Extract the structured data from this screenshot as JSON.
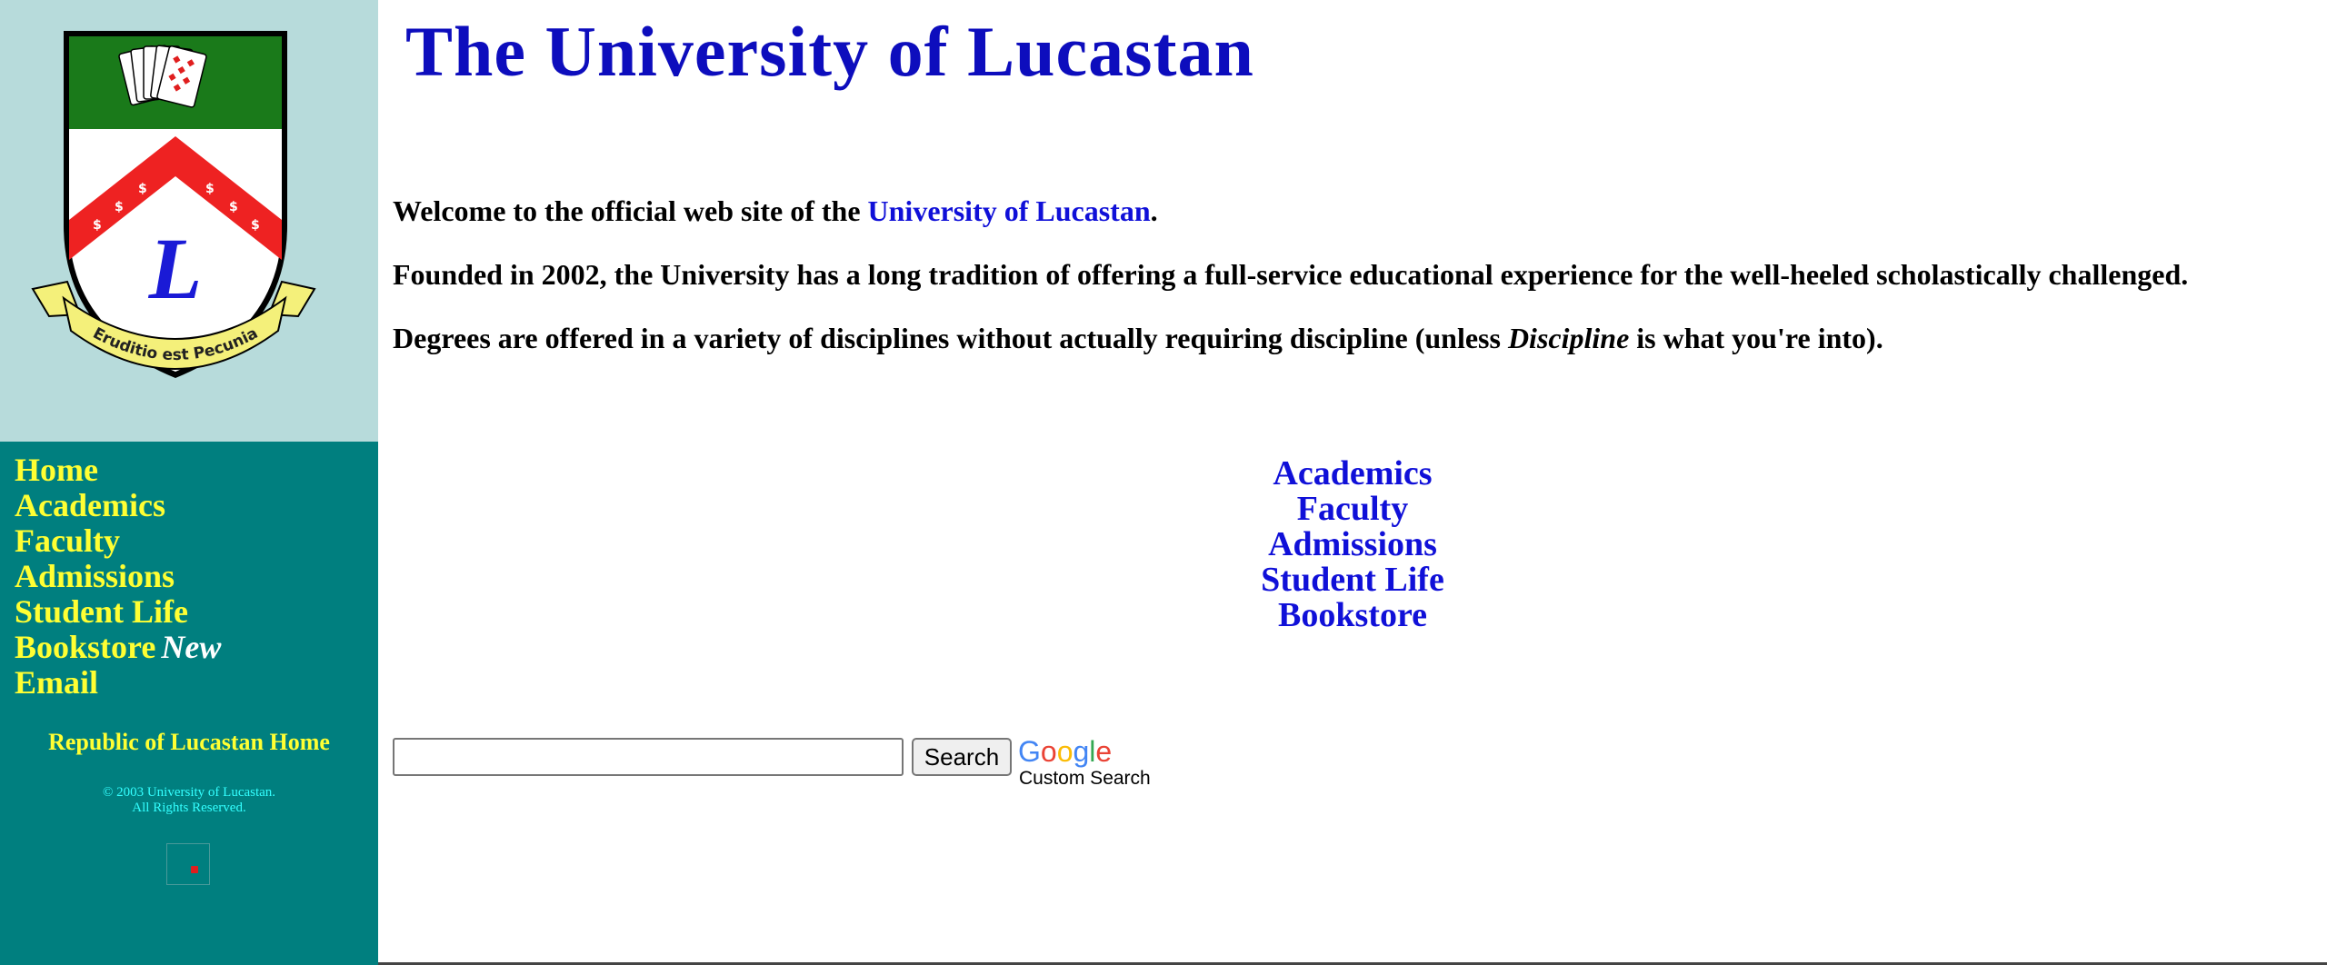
{
  "colors": {
    "sidebar_top": "#b7dbdb",
    "sidebar_nav": "#007f7f",
    "nav_text": "#ffff33",
    "link_blue": "#1010d8",
    "title_blue": "#0d0dbd",
    "crest_green": "#1a7a1a",
    "crest_red": "#ee2222",
    "banner_yellow": "#f4f07a"
  },
  "crest": {
    "motto": "Eruditio est Pecunia",
    "letter": "L",
    "dollar_sign": "$"
  },
  "sidebar": {
    "nav": [
      {
        "label": "Home"
      },
      {
        "label": "Academics"
      },
      {
        "label": "Faculty"
      },
      {
        "label": "Admissions"
      },
      {
        "label": "Student Life"
      },
      {
        "label": "Bookstore",
        "tag": "New"
      },
      {
        "label": "Email"
      }
    ],
    "republic_link": "Republic of Lucastan Home",
    "copyright_line1": "© 2003 University of Lucastan.",
    "copyright_line2": "All Rights Reserved."
  },
  "main": {
    "title": "The University of Lucastan",
    "welcome": {
      "before": "Welcome to the official web site of the ",
      "link": "University of Lucastan",
      "after": "."
    },
    "founded": "Founded in 2002, the University has a long tradition of offering a full-service educational experience for the well-heeled scholastically challenged.",
    "degrees": {
      "before": "Degrees are offered in a variety of disciplines without actually requiring discipline (unless ",
      "em": "Discipline",
      "after": " is what you're into)."
    },
    "center_links": [
      "Academics",
      "Faculty",
      "Admissions",
      "Student Life",
      "Bookstore"
    ]
  },
  "search": {
    "value": "",
    "button_label": "Search",
    "google_letters": [
      "G",
      "o",
      "o",
      "g",
      "l",
      "e"
    ],
    "custom_search_label": "Custom Search"
  }
}
